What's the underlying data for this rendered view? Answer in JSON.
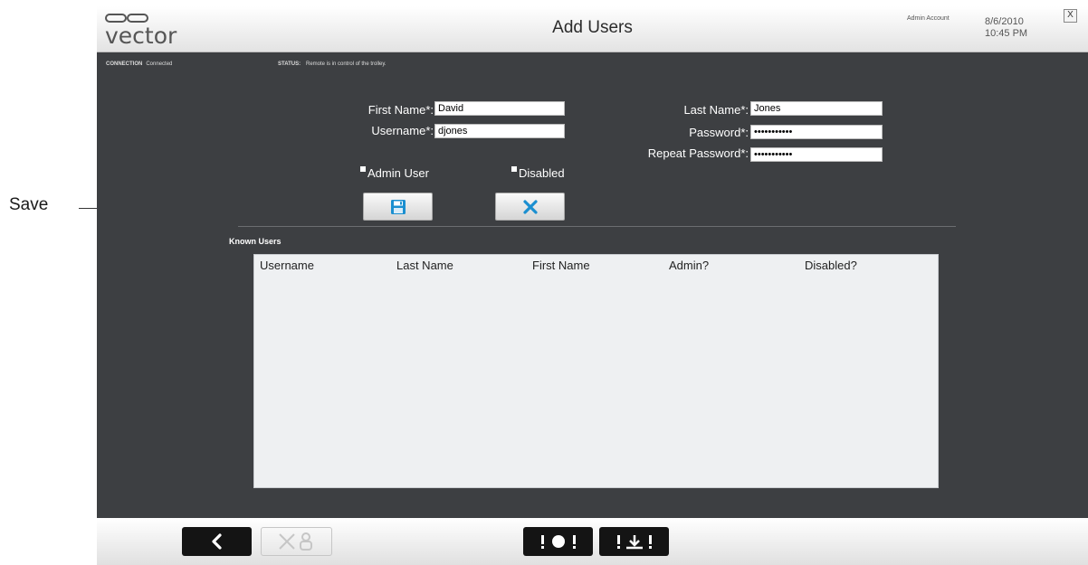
{
  "callout": {
    "label": "Save"
  },
  "header": {
    "logo_text": "vector",
    "title": "Add Users",
    "admin_account": "Admin Account",
    "date": "8/6/2010",
    "time": "10:45 PM",
    "close_label": "X"
  },
  "status": {
    "connection_label": "CONNECTION",
    "connection_value": "Connected",
    "status_label": "STATUS:",
    "status_value": "Remote is in control of the trolley."
  },
  "form": {
    "first_name_label": "First Name*:",
    "first_name_value": "David",
    "username_label": "Username*:",
    "username_value": "djones",
    "last_name_label": "Last Name*:",
    "last_name_value": "Jones",
    "password_label": "Password*:",
    "password_value": "•••••••••••",
    "repeat_password_label": "Repeat Password*:",
    "repeat_password_value": "•••••••••••",
    "admin_user_label": "Admin User",
    "disabled_label": "Disabled"
  },
  "known_users": {
    "title": "Known Users",
    "columns": [
      "Username",
      "Last Name",
      "First Name",
      "Admin?",
      "Disabled?"
    ],
    "rows": []
  },
  "icons": {
    "save": "floppy-disk-icon",
    "cancel": "x-icon",
    "back": "chevron-left-icon",
    "delete_user": "delete-user-icon",
    "stop": "stop-icon",
    "dock": "dock-icon"
  },
  "colors": {
    "app_bg": "#3d3f42",
    "accent_blue": "#1b8fd0",
    "table_bg": "#eef0f2"
  }
}
